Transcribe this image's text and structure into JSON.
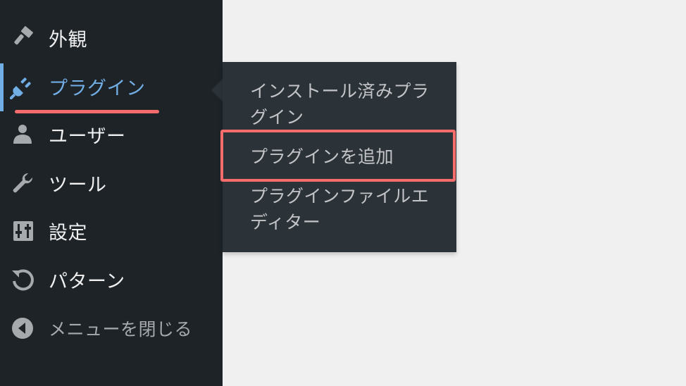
{
  "sidebar": {
    "items": [
      {
        "label": "外観",
        "icon": "paint-brush-icon"
      },
      {
        "label": "プラグイン",
        "icon": "plugin-icon",
        "active": true
      },
      {
        "label": "ユーザー",
        "icon": "user-icon"
      },
      {
        "label": "ツール",
        "icon": "wrench-icon"
      },
      {
        "label": "設定",
        "icon": "settings-sliders-icon"
      },
      {
        "label": "パターン",
        "icon": "patterns-refresh-icon"
      },
      {
        "label": "メニューを閉じる",
        "icon": "collapse-arrow-icon"
      }
    ]
  },
  "submenu": {
    "items": [
      {
        "label": "インストール済みプラグイン"
      },
      {
        "label": "プラグインを追加"
      },
      {
        "label": "プラグインファイルエディター"
      }
    ]
  },
  "colors": {
    "sidebar_bg": "#1d2327",
    "submenu_bg": "#2c3338",
    "accent": "#72aee6",
    "highlight": "#f46c6c",
    "content_bg": "#f0f0f1"
  }
}
